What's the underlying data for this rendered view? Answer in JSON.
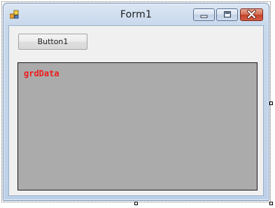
{
  "window": {
    "title": "Form1"
  },
  "form": {
    "button_label": "Button1",
    "grid_label": "grdData"
  },
  "icons": {
    "app": "form-app-icon",
    "minimize": "minimize-icon",
    "maximize": "maximize-icon",
    "close": "close-icon"
  },
  "colors": {
    "grid_background": "#ababab",
    "grid_label": "#ee1c1c",
    "form_background": "#f0f0f0",
    "close_button": "#c2412a"
  }
}
